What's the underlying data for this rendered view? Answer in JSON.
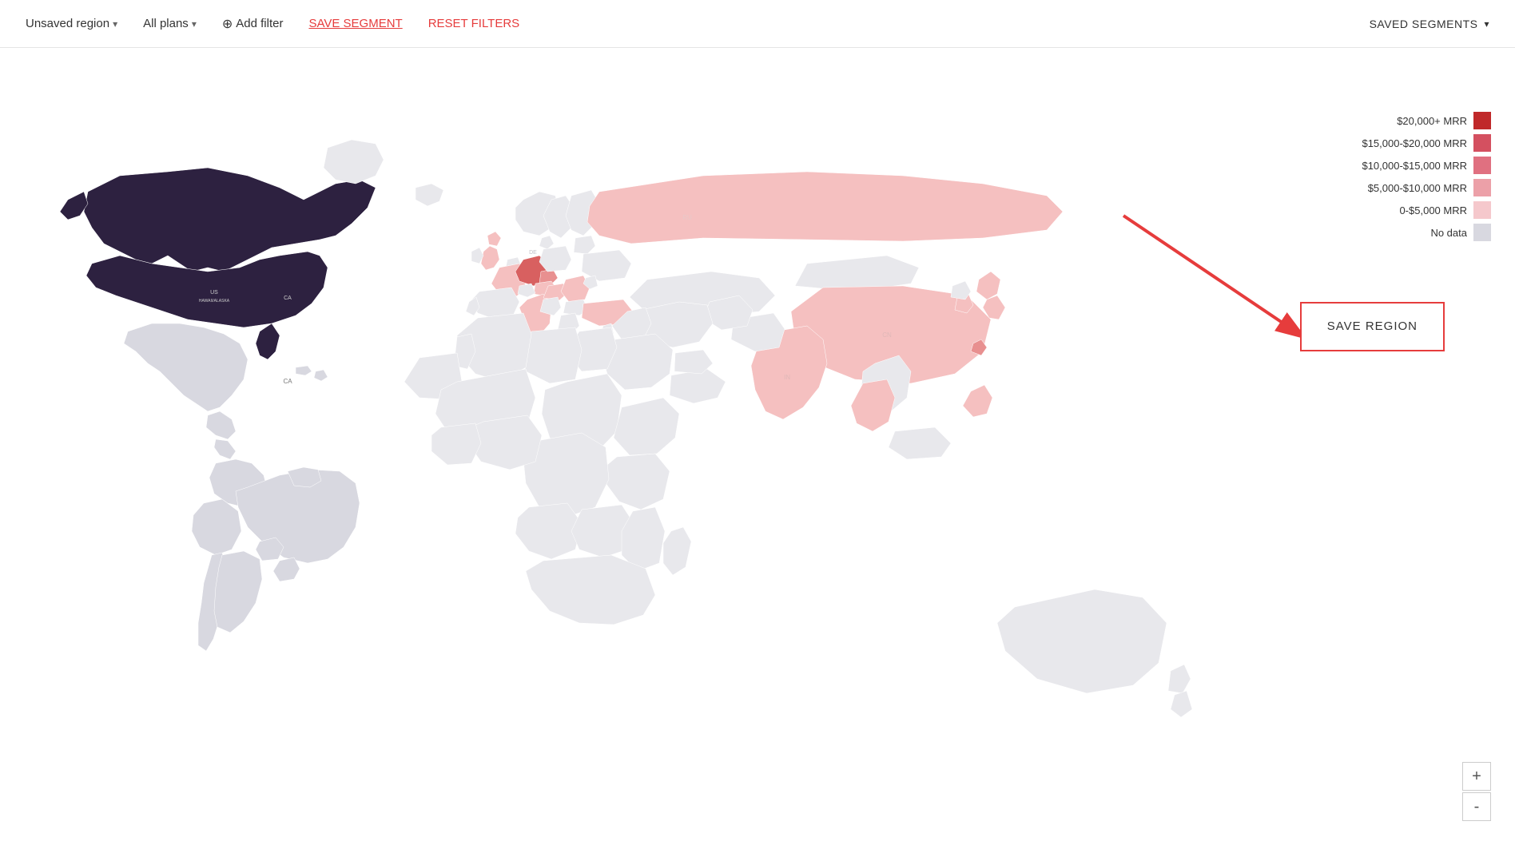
{
  "toolbar": {
    "region_label": "Unsaved region",
    "plans_label": "All plans",
    "add_filter_label": "Add filter",
    "save_segment_label": "SAVE SEGMENT",
    "reset_filters_label": "RESET FILTERS",
    "saved_segments_label": "SAVED SEGMENTS"
  },
  "legend": {
    "items": [
      {
        "label": "$20,000+ MRR",
        "color": "#c0292a"
      },
      {
        "label": "$15,000-$20,000 MRR",
        "color": "#d45060"
      },
      {
        "label": "$10,000-$15,000 MRR",
        "color": "#e07080"
      },
      {
        "label": "$5,000-$10,000 MRR",
        "color": "#eca0a8"
      },
      {
        "label": "0-$5,000 MRR",
        "color": "#f5c8cc"
      },
      {
        "label": "No data",
        "color": "#d8d8e0"
      }
    ]
  },
  "save_region": {
    "label": "SAVE REGION"
  },
  "zoom": {
    "plus_label": "+",
    "minus_label": "-"
  }
}
